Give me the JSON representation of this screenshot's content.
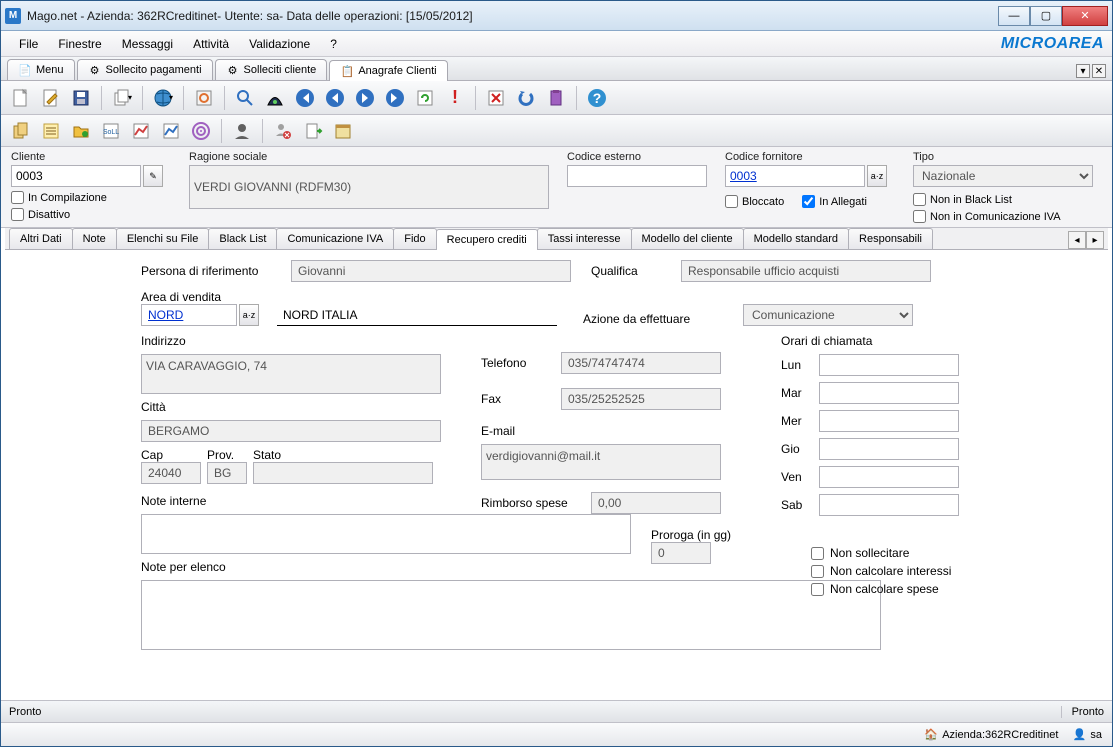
{
  "window": {
    "title": "Mago.net - Azienda: 362RCreditinet- Utente: sa- Data delle operazioni: [15/05/2012]"
  },
  "menubar": [
    "File",
    "Finestre",
    "Messaggi",
    "Attività",
    "Validazione",
    "?"
  ],
  "brand": "MICROAREA",
  "doc_tabs": [
    {
      "label": "Menu",
      "icon": "menu"
    },
    {
      "label": "Sollecito pagamenti",
      "icon": "gear"
    },
    {
      "label": "Solleciti cliente",
      "icon": "gear"
    },
    {
      "label": "Anagrafe Clienti",
      "icon": "form"
    }
  ],
  "doc_tabs_active": 3,
  "header": {
    "cliente_label": "Cliente",
    "cliente_value": "0003",
    "in_compilazione": "In Compilazione",
    "disattivo": "Disattivo",
    "ragione_label": "Ragione sociale",
    "ragione_value": "VERDI GIOVANNI (RDFM30)",
    "codice_esterno_label": "Codice esterno",
    "codice_esterno_value": "",
    "codice_fornitore_label": "Codice fornitore",
    "codice_fornitore_value": "0003",
    "tipo_label": "Tipo",
    "tipo_value": "Nazionale",
    "bloccato": "Bloccato",
    "in_allegati": "In Allegati",
    "non_black": "Non in Black List",
    "non_com_iva": "Non in Comunicazione IVA"
  },
  "inner_tabs": [
    "Altri Dati",
    "Note",
    "Elenchi su File",
    "Black List",
    "Comunicazione IVA",
    "Fido",
    "Recupero crediti",
    "Tassi interesse",
    "Modello del cliente",
    "Modello standard",
    "Responsabili"
  ],
  "inner_active": 6,
  "form": {
    "persona_rif_label": "Persona di riferimento",
    "persona_rif_value": "Giovanni",
    "qualifica_label": "Qualifica",
    "qualifica_value": "Responsabile ufficio acquisti",
    "area_vendita_label": "Area di vendita",
    "area_vendita_code": "NORD",
    "area_vendita_desc": "NORD ITALIA",
    "azione_label": "Azione da effettuare",
    "azione_value": "Comunicazione",
    "indirizzo_label": "Indirizzo",
    "indirizzo_value": "VIA CARAVAGGIO, 74",
    "citta_label": "Città",
    "citta_value": "BERGAMO",
    "cap_label": "Cap",
    "cap_value": "24040",
    "prov_label": "Prov.",
    "prov_value": "BG",
    "stato_label": "Stato",
    "stato_value": "",
    "telefono_label": "Telefono",
    "telefono_value": "035/74747474",
    "fax_label": "Fax",
    "fax_value": "035/25252525",
    "email_label": "E-mail",
    "email_value": "verdigiovanni@mail.it",
    "rimborso_label": "Rimborso spese",
    "rimborso_value": "0,00",
    "proroga_label": "Proroga (in gg)",
    "proroga_value": "0",
    "note_interne_label": "Note interne",
    "note_interne_value": "",
    "note_elenco_label": "Note per elenco",
    "note_elenco_value": "",
    "orari_label": "Orari di chiamata",
    "days": [
      "Lun",
      "Mar",
      "Mer",
      "Gio",
      "Ven",
      "Sab"
    ],
    "non_sollecitare": "Non sollecitare",
    "non_interessi": "Non calcolare interessi",
    "non_spese": "Non calcolare spese"
  },
  "status": {
    "left": "Pronto",
    "right": "Pronto",
    "azienda": "Azienda:362RCreditinet",
    "user": "sa"
  },
  "colors": {
    "accent": "#2a78c8"
  }
}
